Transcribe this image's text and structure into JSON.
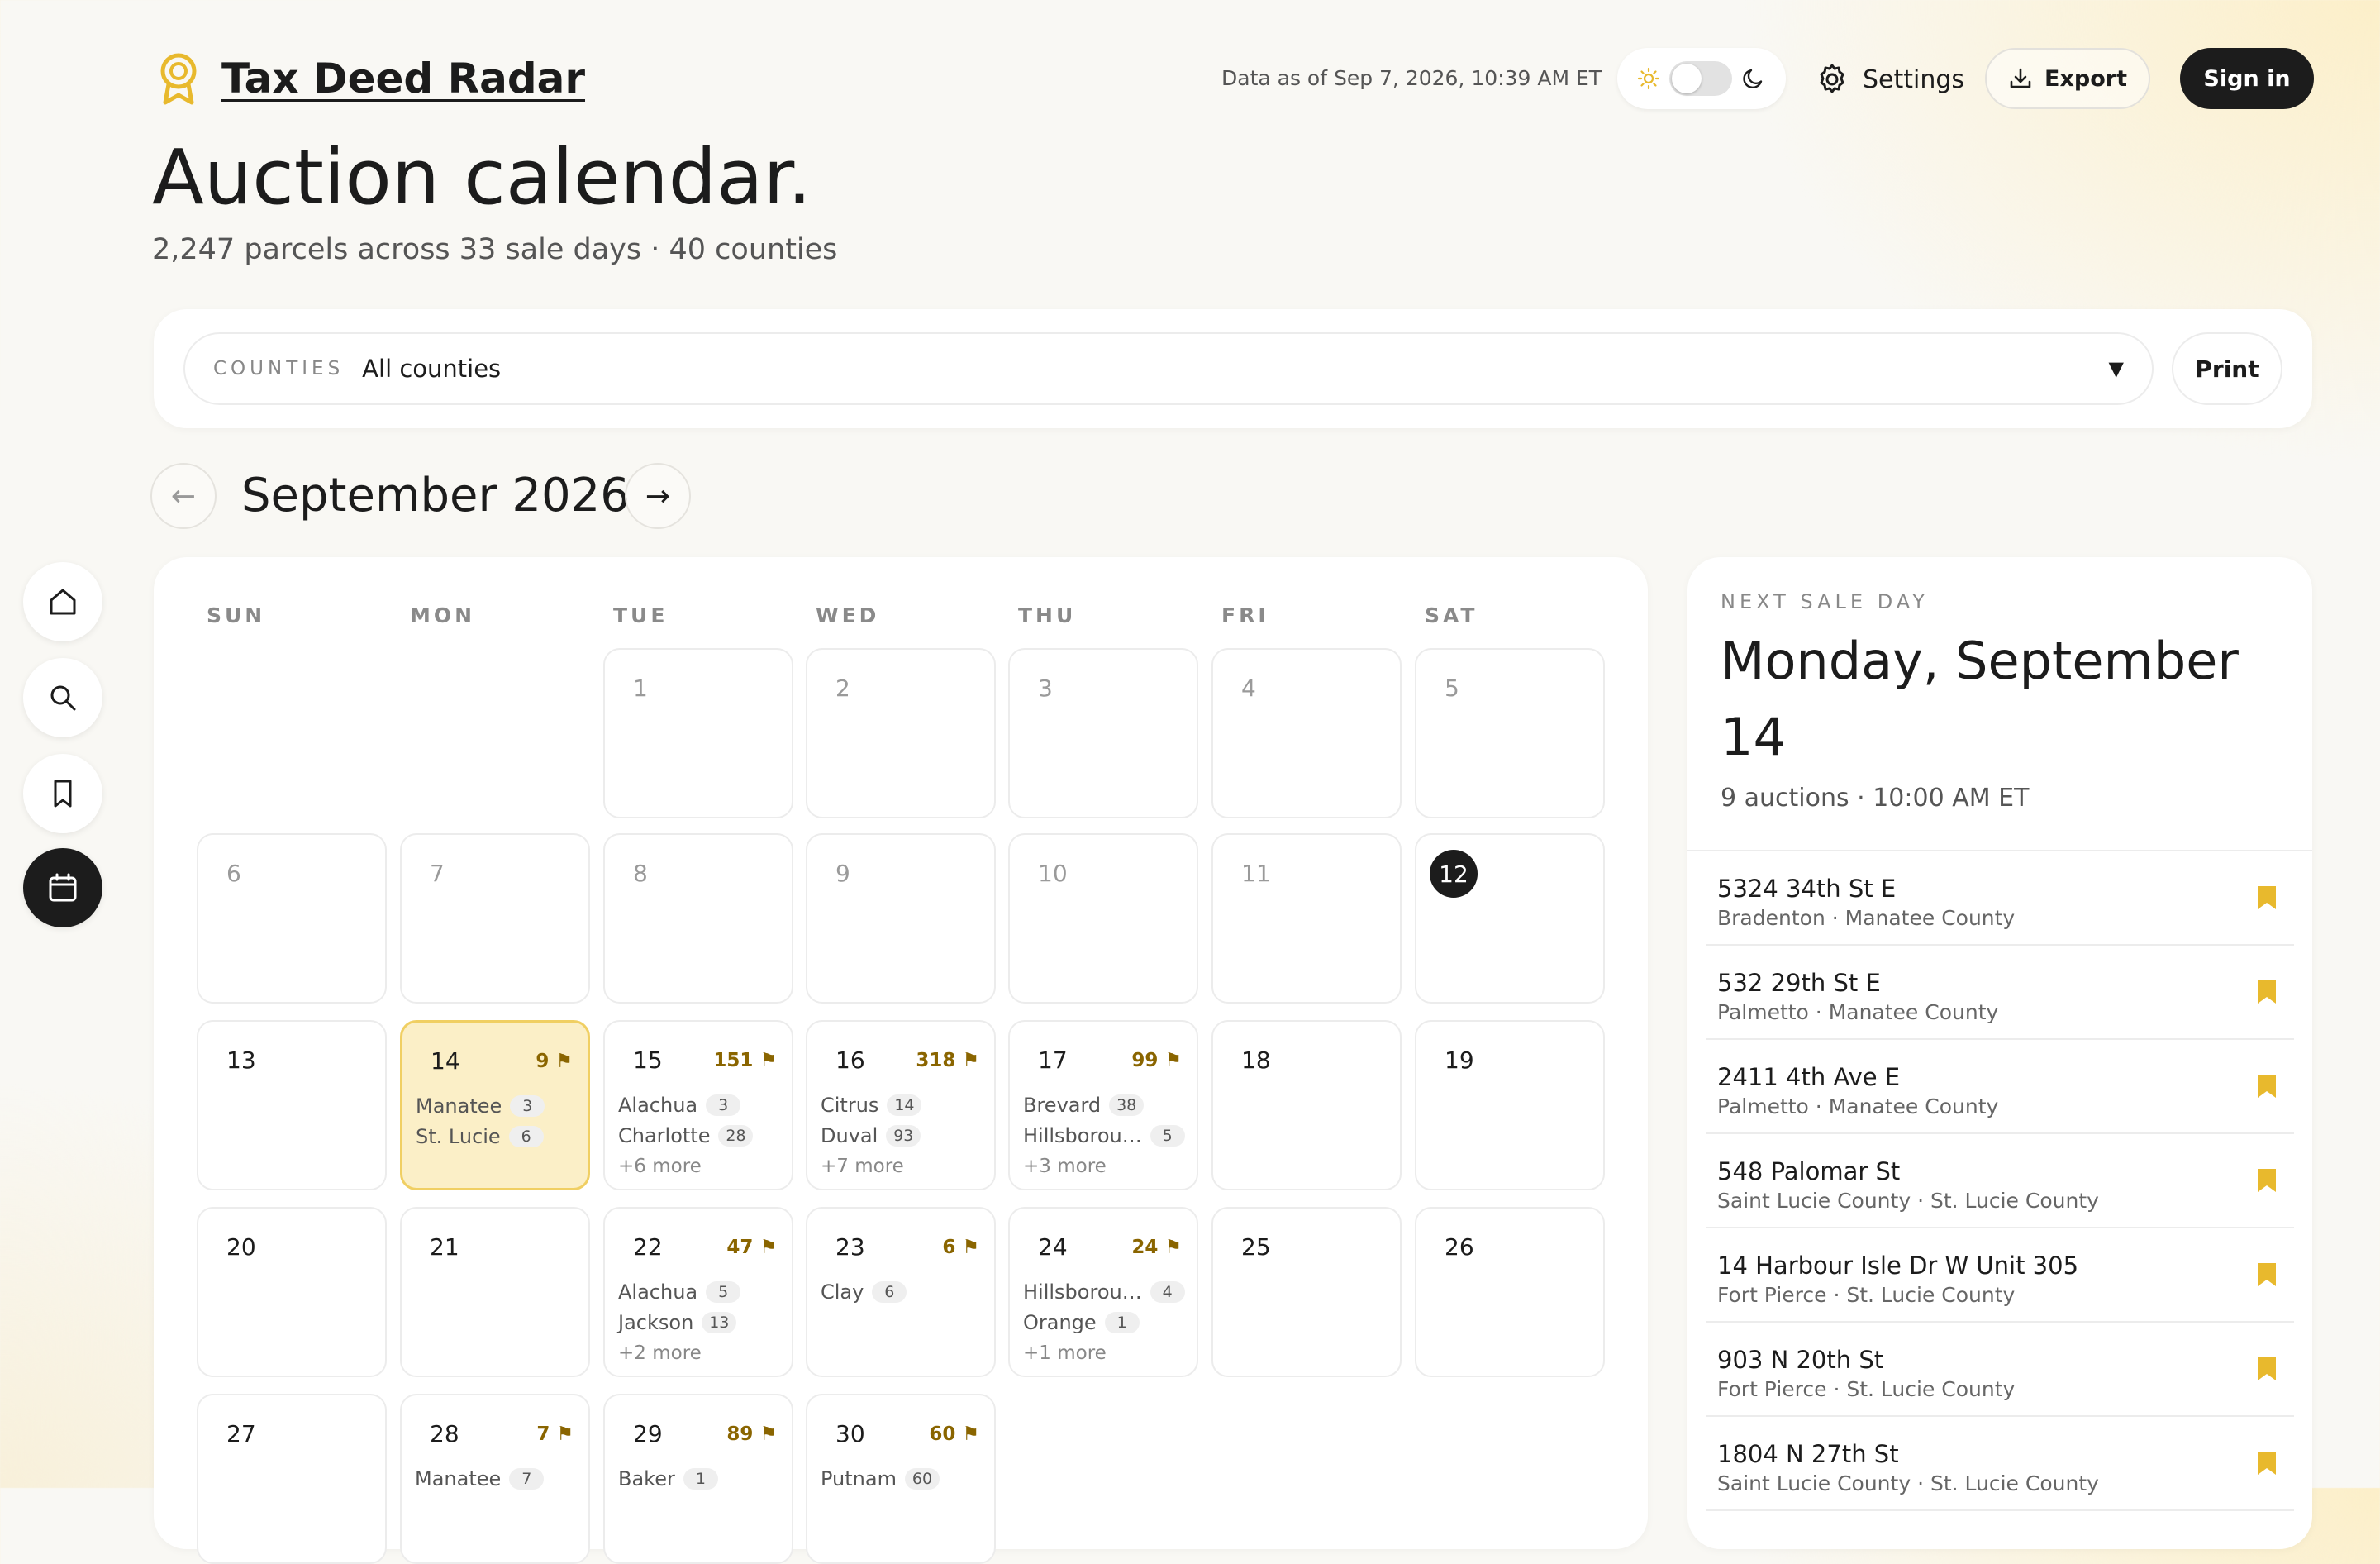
{
  "header": {
    "brand_title": "Tax Deed Radar",
    "data_asof": "Data as of Sep 7, 2026, 10:39 AM ET",
    "settings_label": "Settings",
    "export_label": "Export",
    "signin_label": "Sign in",
    "accent_color": "#e8b92d"
  },
  "page": {
    "title": "Auction calendar.",
    "subtitle": "2,247 parcels across 33 sale days · 40 counties"
  },
  "filter": {
    "counties_label": "COUNTIES",
    "counties_value": "All counties",
    "print_label": "Print"
  },
  "calendar": {
    "month_label": "September 2026",
    "prev_arrow": "←",
    "next_arrow": "→",
    "weekdays": [
      "SUN",
      "MON",
      "TUE",
      "WED",
      "THU",
      "FRI",
      "SAT"
    ],
    "today": 12,
    "selected": 14,
    "days": [
      {
        "day": 1,
        "col": 2,
        "row": 0,
        "past": true
      },
      {
        "day": 2,
        "col": 3,
        "row": 0,
        "past": true
      },
      {
        "day": 3,
        "col": 4,
        "row": 0,
        "past": true
      },
      {
        "day": 4,
        "col": 5,
        "row": 0,
        "past": true
      },
      {
        "day": 5,
        "col": 6,
        "row": 0,
        "past": true
      },
      {
        "day": 6,
        "col": 0,
        "row": 1,
        "past": true
      },
      {
        "day": 7,
        "col": 1,
        "row": 1,
        "past": true
      },
      {
        "day": 8,
        "col": 2,
        "row": 1,
        "past": true
      },
      {
        "day": 9,
        "col": 3,
        "row": 1,
        "past": true
      },
      {
        "day": 10,
        "col": 4,
        "row": 1,
        "past": true
      },
      {
        "day": 11,
        "col": 5,
        "row": 1,
        "past": true
      },
      {
        "day": 12,
        "col": 6,
        "row": 1,
        "today": true
      },
      {
        "day": 13,
        "col": 0,
        "row": 2
      },
      {
        "day": 14,
        "col": 1,
        "row": 2,
        "count": "9 ⚑",
        "lines": [
          {
            "name": "Manatee",
            "n": "3"
          },
          {
            "name": "St. Lucie",
            "n": "6"
          }
        ]
      },
      {
        "day": 15,
        "col": 2,
        "row": 2,
        "count": "151 ⚑",
        "lines": [
          {
            "name": "Alachua",
            "n": "3"
          },
          {
            "name": "Charlotte",
            "n": "28"
          }
        ],
        "more": "+6 more"
      },
      {
        "day": 16,
        "col": 3,
        "row": 2,
        "count": "318 ⚑",
        "lines": [
          {
            "name": "Citrus",
            "n": "14"
          },
          {
            "name": "Duval",
            "n": "93"
          }
        ],
        "more": "+7 more"
      },
      {
        "day": 17,
        "col": 4,
        "row": 2,
        "count": "99 ⚑",
        "lines": [
          {
            "name": "Brevard",
            "n": "38"
          },
          {
            "name": "Hillsborou…",
            "n": "5"
          }
        ],
        "more": "+3 more"
      },
      {
        "day": 18,
        "col": 5,
        "row": 2
      },
      {
        "day": 19,
        "col": 6,
        "row": 2
      },
      {
        "day": 20,
        "col": 0,
        "row": 3
      },
      {
        "day": 21,
        "col": 1,
        "row": 3
      },
      {
        "day": 22,
        "col": 2,
        "row": 3,
        "count": "47 ⚑",
        "lines": [
          {
            "name": "Alachua",
            "n": "5"
          },
          {
            "name": "Jackson",
            "n": "13"
          }
        ],
        "more": "+2 more"
      },
      {
        "day": 23,
        "col": 3,
        "row": 3,
        "count": "6 ⚑",
        "lines": [
          {
            "name": "Clay",
            "n": "6"
          }
        ]
      },
      {
        "day": 24,
        "col": 4,
        "row": 3,
        "count": "24 ⚑",
        "lines": [
          {
            "name": "Hillsborou…",
            "n": "4"
          },
          {
            "name": "Orange",
            "n": "1"
          }
        ],
        "more": "+1 more"
      },
      {
        "day": 25,
        "col": 5,
        "row": 3
      },
      {
        "day": 26,
        "col": 6,
        "row": 3
      },
      {
        "day": 27,
        "col": 0,
        "row": 4
      },
      {
        "day": 28,
        "col": 1,
        "row": 4,
        "count": "7 ⚑",
        "lines": [
          {
            "name": "Manatee",
            "n": "7"
          }
        ]
      },
      {
        "day": 29,
        "col": 2,
        "row": 4,
        "count": "89 ⚑",
        "lines": [
          {
            "name": "Baker",
            "n": "1"
          }
        ]
      },
      {
        "day": 30,
        "col": 3,
        "row": 4,
        "count": "60 ⚑",
        "lines": [
          {
            "name": "Putnam",
            "n": "60"
          }
        ]
      }
    ]
  },
  "next_sale": {
    "kicker": "NEXT SALE DAY",
    "title": "Monday, September 14",
    "meta": "9 auctions · 10:00 AM ET",
    "items": [
      {
        "address": "5324 34th St E",
        "location": "Bradenton · Manatee County"
      },
      {
        "address": "532 29th St E",
        "location": "Palmetto · Manatee County"
      },
      {
        "address": "2411 4th Ave E",
        "location": "Palmetto · Manatee County"
      },
      {
        "address": "548 Palomar St",
        "location": "Saint Lucie County · St. Lucie County"
      },
      {
        "address": "14 Harbour Isle Dr W Unit 305",
        "location": "Fort Pierce · St. Lucie County"
      },
      {
        "address": "903 N 20th St",
        "location": "Fort Pierce · St. Lucie County"
      },
      {
        "address": "1804 N 27th St",
        "location": "Saint Lucie County · St. Lucie County"
      }
    ]
  },
  "rail": [
    {
      "name": "home",
      "icon": "home-icon"
    },
    {
      "name": "search",
      "icon": "search-icon"
    },
    {
      "name": "saved",
      "icon": "bookmark-icon"
    },
    {
      "name": "calendar",
      "icon": "calendar-icon",
      "active": true
    }
  ]
}
